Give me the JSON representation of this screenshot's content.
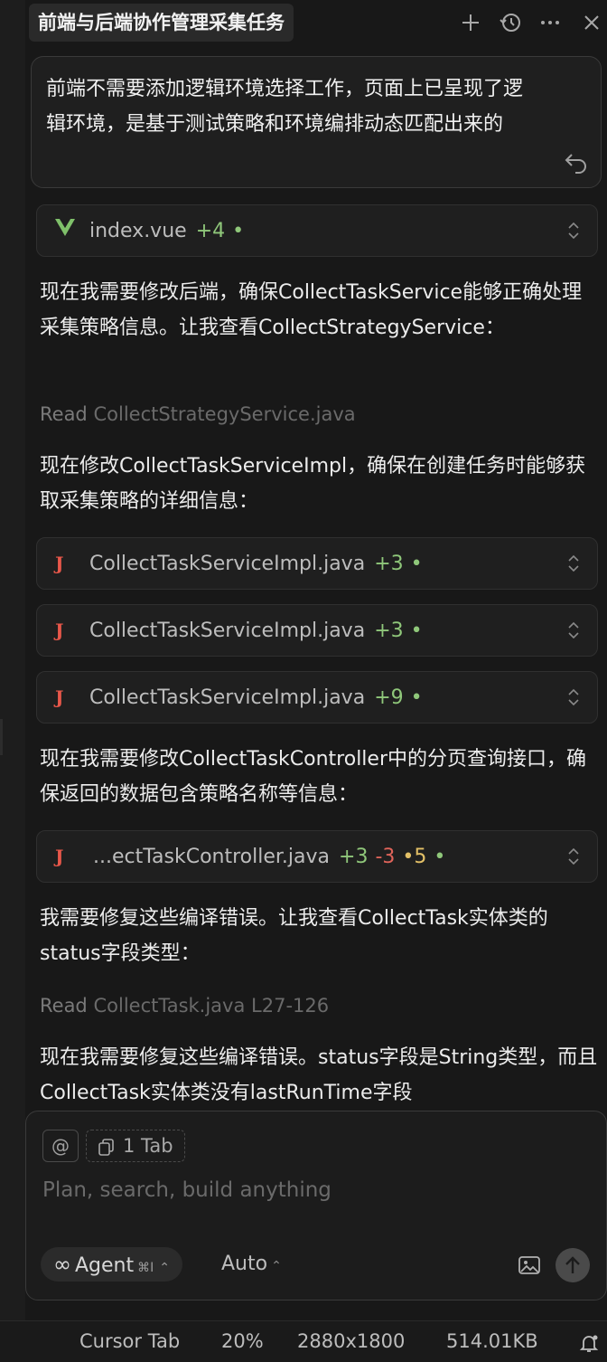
{
  "header": {
    "title": "前端与后端协作管理采集任务",
    "icons": [
      "plus-icon",
      "history-icon",
      "more-icon",
      "close-icon"
    ]
  },
  "conversation": {
    "user_message": "前端不需要添加逻辑环境选择工作，页面上已呈现了逻辑环境，是基于测试策略和环境编排动态匹配出来的",
    "file_index_vue": {
      "name": "index.vue",
      "added": "+4",
      "dot": "•"
    },
    "ai_text_1": "现在我需要修改后端，确保CollectTaskService能够正确处理采集策略信息。让我查看CollectStrategyService：",
    "read_1": {
      "label": "Read",
      "file": "CollectStrategyService.java"
    },
    "ai_text_2": "现在修改CollectTaskServiceImpl，确保在创建任务时能够获取采集策略的详细信息：",
    "file_impl_1": {
      "icon": "J",
      "name": "CollectTaskServiceImpl.java",
      "added": "+3",
      "dot": "•"
    },
    "file_impl_2": {
      "icon": "J",
      "name": "CollectTaskServiceImpl.java",
      "added": "+3",
      "dot": "•"
    },
    "file_impl_3": {
      "icon": "J",
      "name": "CollectTaskServiceImpl.java",
      "added": "+9",
      "dot": "•"
    },
    "ai_text_3": "现在我需要修改CollectTaskController中的分页查询接口，确保返回的数据包含策略名称等信息：",
    "file_controller": {
      "icon": "J",
      "name": "...ectTaskController.java",
      "added": "+3",
      "removed": "-3",
      "modified": "•5",
      "dot": "•"
    },
    "ai_text_4": "我需要修复这些编译错误。让我查看CollectTask实体类的status字段类型：",
    "read_2": {
      "label": "Read",
      "file": "CollectTask.java L27-126"
    },
    "ai_text_5": "现在我需要修复这些编译错误。status字段是String类型，而且CollectTask实体类没有lastRunTime字段"
  },
  "composer": {
    "at_label": "@",
    "tab_chip": "1 Tab",
    "placeholder": "Plan, search, build anything",
    "mode": "Agent",
    "mode_shortcut": "⌘I",
    "model": "Auto"
  },
  "statusbar": {
    "cursor_tab": "Cursor Tab",
    "zoom": "20%",
    "dimensions": "2880x1800",
    "file_size": "514.01KB"
  }
}
